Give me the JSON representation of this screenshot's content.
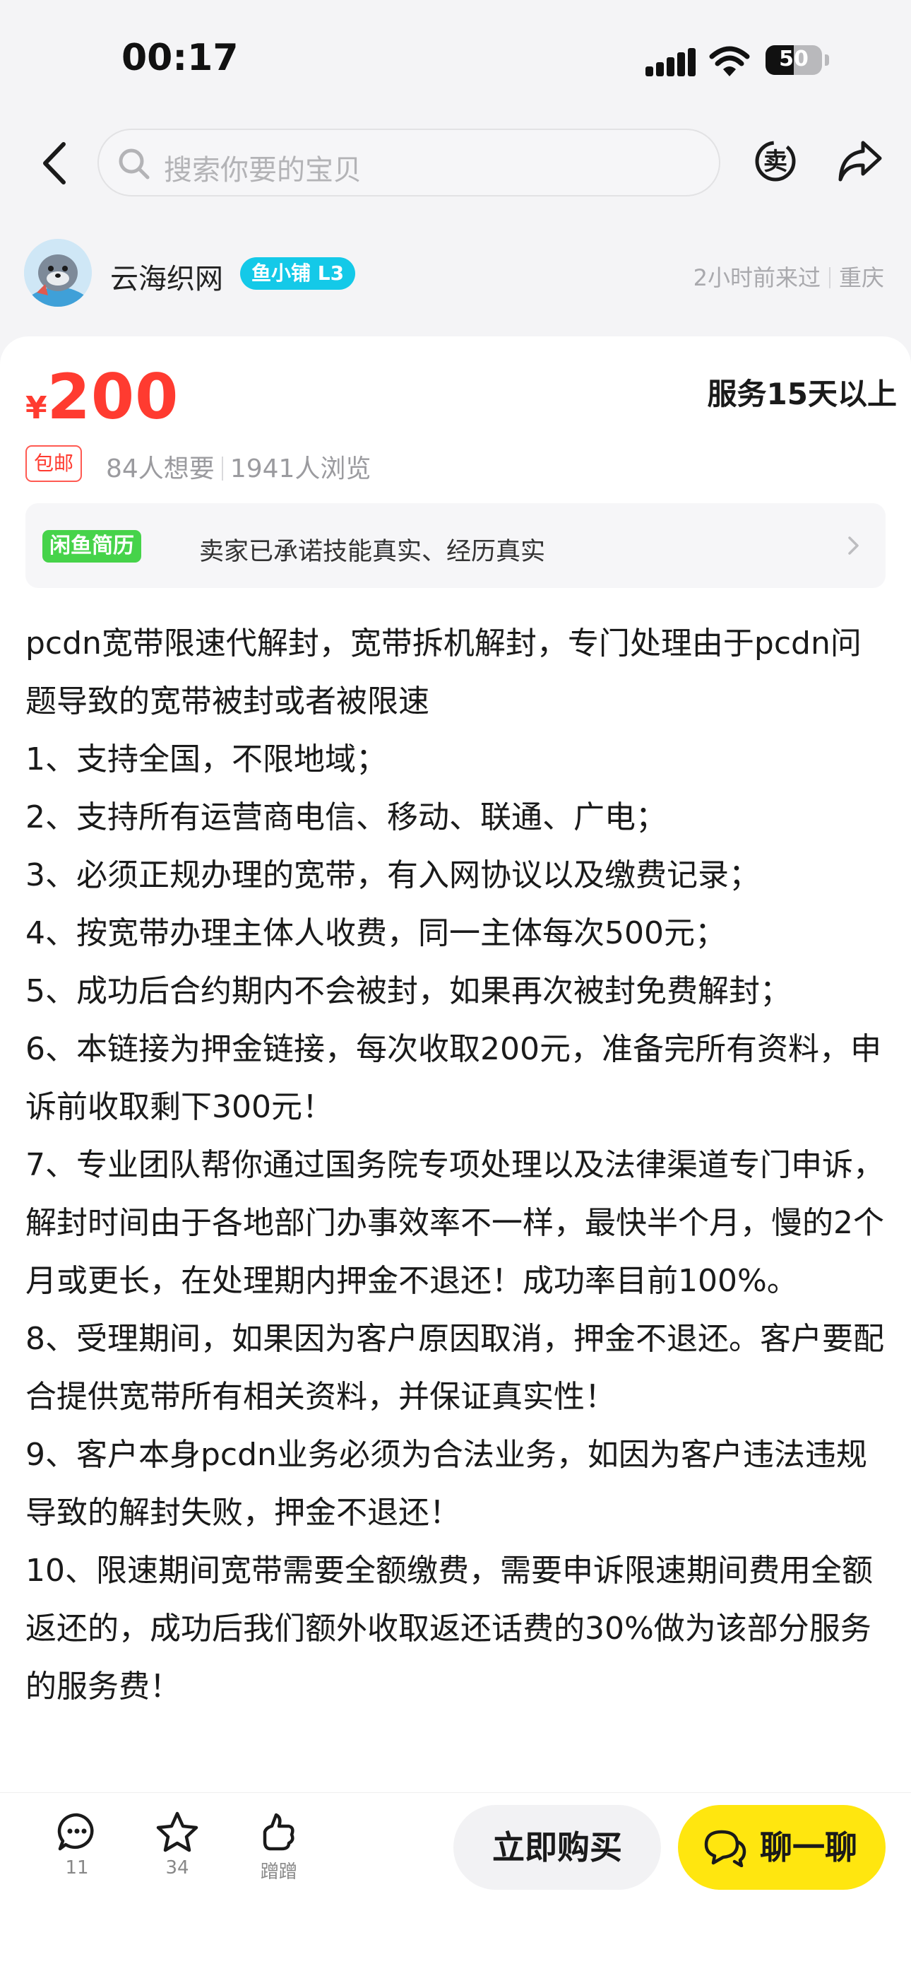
{
  "status_bar": {
    "time": "00:17",
    "battery": "50",
    "battery_level": 0.5
  },
  "nav": {
    "search_placeholder": "搜索你要的宝贝",
    "sell_icon_label": "卖"
  },
  "seller": {
    "name": "云海织网",
    "badge": "鱼小铺 L3",
    "last_visit": "2小时前来过",
    "location": "重庆"
  },
  "product": {
    "currency": "¥",
    "price": "200",
    "service_tag": "服务15天以上",
    "shipping_tag": "包邮",
    "wants": "84人想要",
    "views": "1941人浏览"
  },
  "resume": {
    "badge": "闲鱼简历",
    "text": "卖家已承诺技能真实、经历真实"
  },
  "description": [
    "pcdn宽带限速代解封，宽带拆机解封，专门处理由于pcdn问题导致的宽带被封或者被限速",
    "1、支持全国，不限地域；",
    "2、支持所有运营商电信、移动、联通、广电；",
    "3、必须正规办理的宽带，有入网协议以及缴费记录；",
    "4、按宽带办理主体人收费，同一主体每次500元；",
    "5、成功后合约期内不会被封，如果再次被封免费解封；",
    "6、本链接为押金链接，每次收取200元，准备完所有资料，申诉前收取剩下300元！",
    "7、专业团队帮你通过国务院专项处理以及法律渠道专门申诉，解封时间由于各地部门办事效率不一样，最快半个月，慢的2个月或更长，在处理期内押金不退还！成功率目前100%。",
    "8、受理期间，如果因为客户原因取消，押金不退还。客户要配合提供宽带所有相关资料，并保证真实性！",
    "9、客户本身pcdn业务必须为合法业务，如因为客户违法违规导致的解封失败，押金不退还！",
    "10、限速期间宽带需要全额缴费，需要申诉限速期间费用全额返还的，成功后我们额外收取返还话费的30%做为该部分服务的服务费！"
  ],
  "bottom_bar": {
    "comment_count": "11",
    "favorite_count": "34",
    "nudge_label": "蹭蹭",
    "buy_label": "立即购买",
    "chat_label": "聊一聊"
  },
  "colors": {
    "price_red": "#ff3b30",
    "chat_yellow": "#ffe60f",
    "badge_cyan": "#14c9e8",
    "resume_green": "#46d34a",
    "service_highlight": "#ffe14d"
  }
}
